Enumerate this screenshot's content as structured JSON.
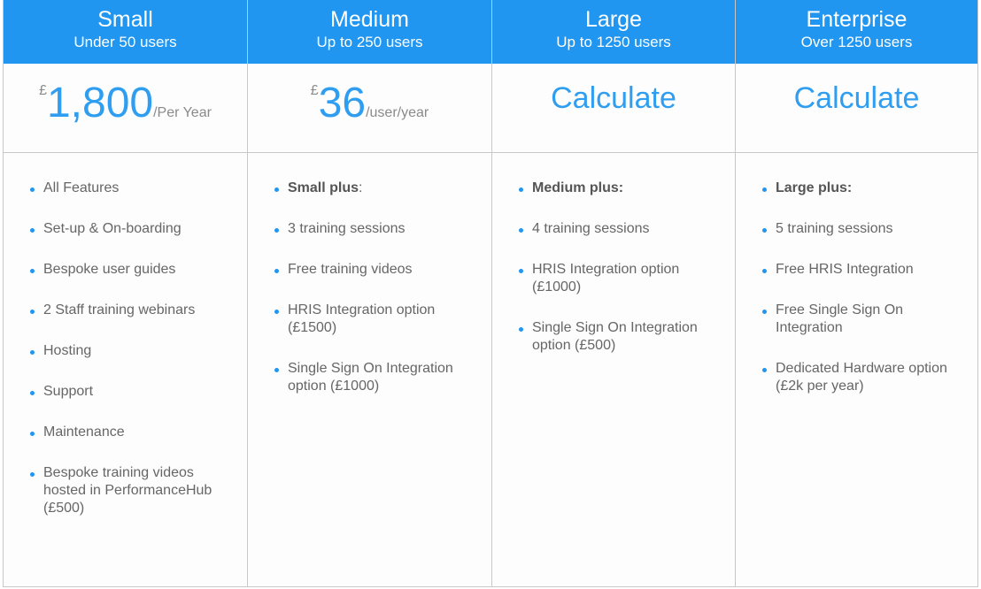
{
  "colors": {
    "header_bg": "#2196f0",
    "accent_text": "#2f9ef0",
    "body_text": "#666666",
    "muted_text": "#8a8a8a",
    "border": "#c8c8c8"
  },
  "plans": [
    {
      "name": "Small",
      "users": "Under 50 users",
      "price": {
        "currency": "£",
        "amount": "1,800",
        "period": "/Per Year"
      },
      "features": [
        {
          "text": "All Features"
        },
        {
          "text": "Set-up & On-boarding"
        },
        {
          "text": "Bespoke user guides"
        },
        {
          "text": "2 Staff training webinars"
        },
        {
          "text": "Hosting"
        },
        {
          "text": "Support"
        },
        {
          "text": "Maintenance"
        },
        {
          "text": "Bespoke training videos hosted in PerformanceHub (£500)"
        }
      ]
    },
    {
      "name": "Medium",
      "users": "Up to 250 users",
      "price": {
        "currency": "£",
        "amount": "36",
        "period": "/user/year"
      },
      "features": [
        {
          "bold": "Small plus",
          "text": ":"
        },
        {
          "text": "3 training sessions"
        },
        {
          "text": "Free training videos"
        },
        {
          "text": "HRIS Integration option (£1500)"
        },
        {
          "text": "Single Sign On Integration option (£1000)"
        }
      ]
    },
    {
      "name": "Large",
      "users": "Up to 1250 users",
      "price": {
        "calculate_label": "Calculate"
      },
      "features": [
        {
          "bold": "Medium plus:",
          "text": ""
        },
        {
          "text": "4 training sessions"
        },
        {
          "text": "HRIS Integration option (£1000)"
        },
        {
          "text": "Single Sign On Integration option (£500)"
        }
      ]
    },
    {
      "name": "Enterprise",
      "users": "Over 1250 users",
      "price": {
        "calculate_label": "Calculate"
      },
      "features": [
        {
          "bold": "Large plus:",
          "text": ""
        },
        {
          "text": "5 training sessions"
        },
        {
          "text": "Free HRIS Integration"
        },
        {
          "text": "Free Single Sign On Integration"
        },
        {
          "text": "Dedicated Hardware option (£2k per year)"
        }
      ]
    }
  ]
}
